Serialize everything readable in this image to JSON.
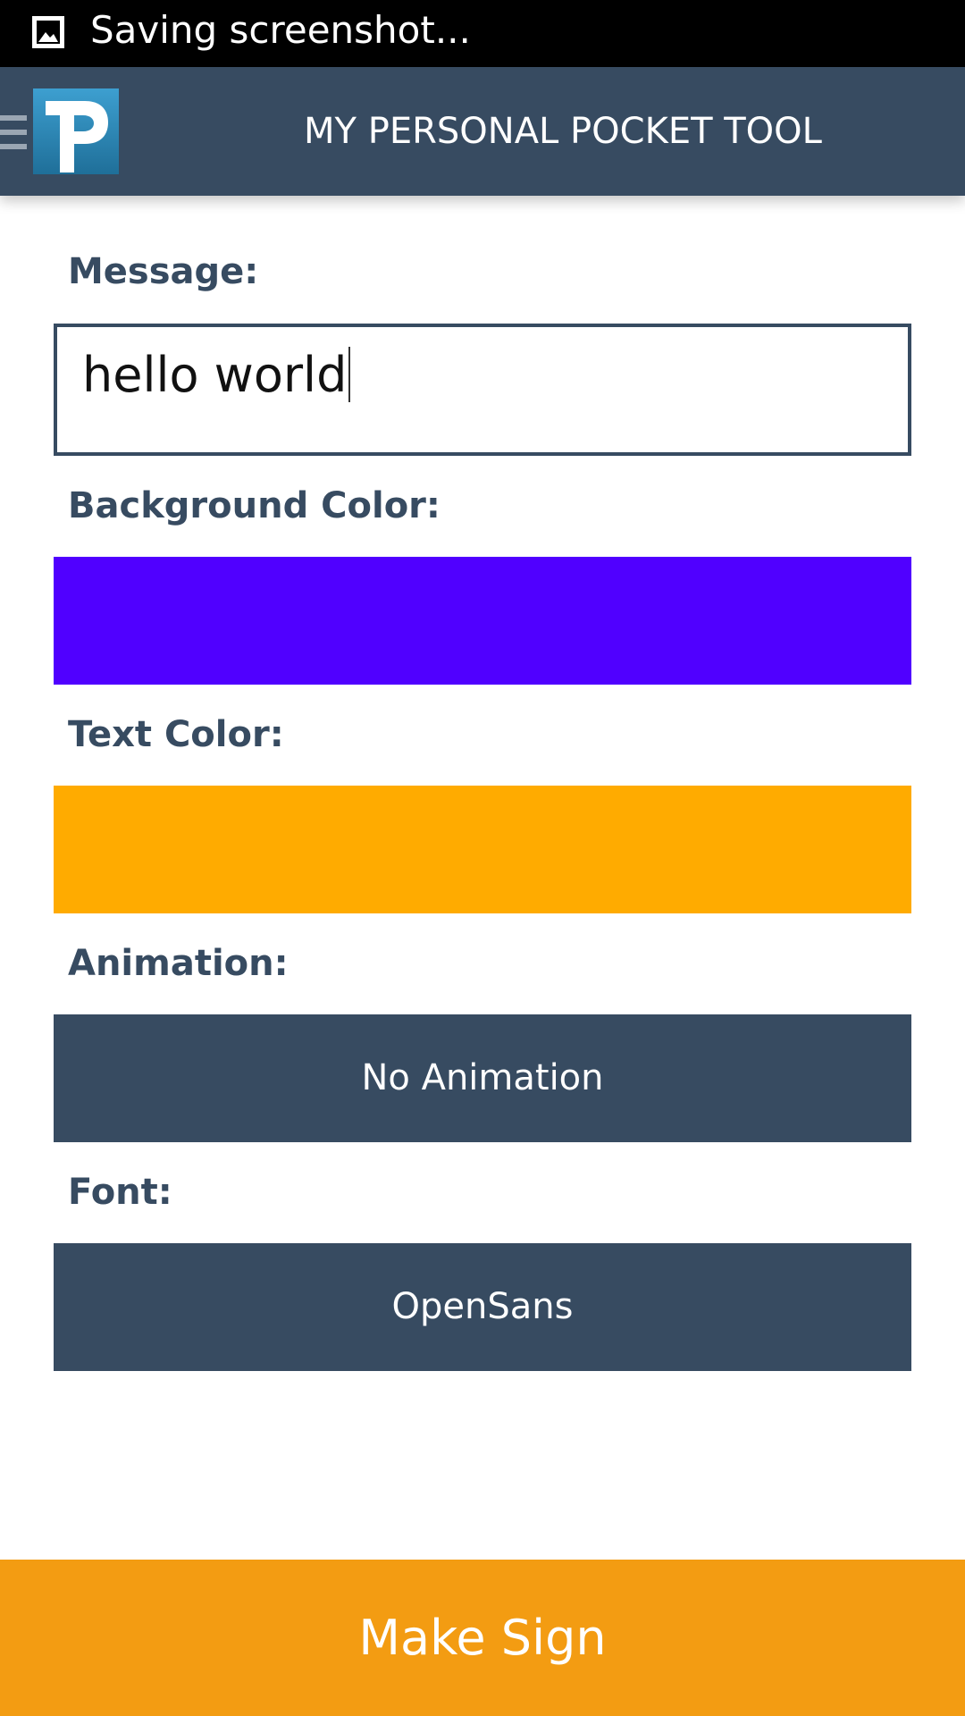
{
  "status_bar": {
    "icon": "image-icon",
    "text": "Saving screenshot..."
  },
  "app_bar": {
    "menu_icon": "menu-icon",
    "logo_icon": "p-logo-icon",
    "title": "MY PERSONAL POCKET TOOL"
  },
  "form": {
    "message": {
      "label": "Message:",
      "value": "hello world"
    },
    "background_color": {
      "label": "Background Color:",
      "value": "#5000ff"
    },
    "text_color": {
      "label": "Text Color:",
      "value": "#ffab00"
    },
    "animation": {
      "label": "Animation:",
      "value": "No Animation"
    },
    "font": {
      "label": "Font:",
      "value": "OpenSans"
    }
  },
  "actions": {
    "make_sign_label": "Make Sign"
  },
  "colors": {
    "primary": "#374b61",
    "accent": "#f39c12"
  }
}
